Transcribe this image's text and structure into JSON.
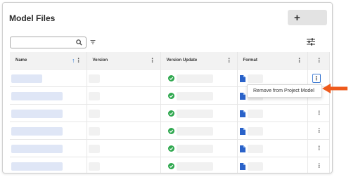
{
  "page": {
    "title": "Model Files"
  },
  "toolbar": {
    "add_label": "+"
  },
  "search": {
    "placeholder": ""
  },
  "table": {
    "columns": [
      {
        "key": "name",
        "label": "Name",
        "sorted": "ascending"
      },
      {
        "key": "version",
        "label": "Version"
      },
      {
        "key": "version_update",
        "label": "Version Update"
      },
      {
        "key": "format",
        "label": "Format"
      },
      {
        "key": "actions",
        "label": ""
      }
    ],
    "rows": [
      {
        "name": "",
        "version": "",
        "version_update": "",
        "format": "",
        "status": "ok"
      },
      {
        "name": "",
        "version": "",
        "version_update": "",
        "format": "",
        "status": "ok"
      },
      {
        "name": "",
        "version": "",
        "version_update": "",
        "format": "",
        "status": "ok"
      },
      {
        "name": "",
        "version": "",
        "version_update": "",
        "format": "",
        "status": "ok"
      },
      {
        "name": "",
        "version": "",
        "version_update": "",
        "format": "",
        "status": "ok"
      },
      {
        "name": "",
        "version": "",
        "version_update": "",
        "format": "",
        "status": "ok"
      }
    ]
  },
  "context_menu": {
    "items": [
      {
        "label": "Remove from Project Model"
      }
    ]
  },
  "icons": {
    "search": "search-icon",
    "filter": "filter-icon",
    "settings": "sliders-icon",
    "check": "check-circle-icon",
    "format": "file-icon",
    "more": "kebab-menu-icon",
    "callout": "arrow-left-icon"
  },
  "colors": {
    "accent": "#2f7bd5",
    "success": "#2fa84f",
    "callout": "#ee5a1c",
    "placeholder": "#dfe6f6"
  }
}
